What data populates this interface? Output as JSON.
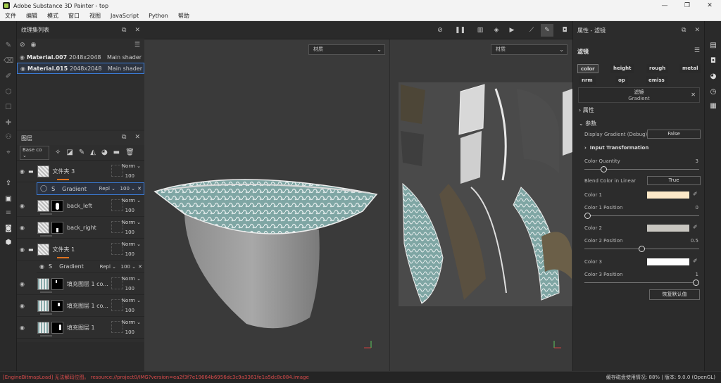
{
  "app": {
    "title": "Adobe Substance 3D Painter - top",
    "window_min": "—",
    "window_max": "❐",
    "window_close": "✕"
  },
  "menu": [
    "文件",
    "编辑",
    "模式",
    "窗口",
    "视图",
    "JavaScript",
    "Python",
    "帮助"
  ],
  "texture_sets": {
    "title": "纹理集列表",
    "items": [
      {
        "name": "Material.007",
        "resolution": "2048x2048",
        "shader": "Main shader"
      },
      {
        "name": "Material.015",
        "resolution": "2048x2048",
        "shader": "Main shader"
      }
    ]
  },
  "layers": {
    "title": "图层",
    "channel": "Base co",
    "items": [
      {
        "name": "文件夹 3",
        "blend": "Norm",
        "opacity": "100",
        "kind": "folder"
      },
      {
        "name": "Gradient",
        "blend": "Repl",
        "opacity": "100",
        "kind": "filter"
      },
      {
        "name": "back_left",
        "blend": "Norm",
        "opacity": "100",
        "kind": "fill"
      },
      {
        "name": "back_right",
        "blend": "Norm",
        "opacity": "100",
        "kind": "fill"
      },
      {
        "name": "文件夹 1",
        "blend": "Norm",
        "opacity": "100",
        "kind": "folder"
      },
      {
        "name": "Gradient",
        "blend": "Repl",
        "opacity": "100",
        "kind": "filter"
      },
      {
        "name": "填充图层 1 co...",
        "blend": "Norm",
        "opacity": "100",
        "kind": "fill"
      },
      {
        "name": "填充图层 1 co...",
        "blend": "Norm",
        "opacity": "100",
        "kind": "fill"
      },
      {
        "name": "填充图层 1",
        "blend": "Norm",
        "opacity": "100",
        "kind": "fill"
      }
    ]
  },
  "viewports": {
    "left_dropdown": "材质",
    "right_dropdown": "材质"
  },
  "properties": {
    "title": "属性 - 滤镜",
    "section_title": "滤镜",
    "channels": [
      "color",
      "height",
      "rough",
      "metal",
      "nrm",
      "op",
      "emiss"
    ],
    "filter_label": "滤镜",
    "filter_name": "Gradient",
    "attributes_label": "属性",
    "params_label": "参数",
    "display_gradient_label": "Display Gradient (Debug)",
    "display_gradient_value": "False",
    "input_transformation": "Input Transformation",
    "color_quantity_label": "Color Quantity",
    "color_quantity_value": "3",
    "color_quantity_fraction": 0.15,
    "blend_linear_label": "Blend Color in Linear",
    "blend_linear_value": "True",
    "color1_label": "Color 1",
    "color1": "#fde9c8",
    "color1_pos_label": "Color 1 Position",
    "color1_pos_value": "0",
    "color2_label": "Color 2",
    "color2": "#c8c6c0",
    "color2_pos_label": "Color 2 Position",
    "color2_pos_value": "0.5",
    "color3_label": "Color 3",
    "color3": "#ffffff",
    "color3_pos_label": "Color 3 Position",
    "color3_pos_value": "1",
    "reset_label": "恢复默认值"
  },
  "status": {
    "error": "[EngineBitmapLoad] 无法解码位图。 resource://project0/IMG?version=ea2f3f7e19664b6956dc3c9a3361fe1a5dc8c084.image",
    "disk": "缓存磁盘使用情况:",
    "disk_value": "88%",
    "version": "版本: 9.0.0 (OpenGL)"
  },
  "colors": {
    "accent": "#e0731f",
    "selection": "#3b7bd4",
    "error": "#d94b4b"
  }
}
